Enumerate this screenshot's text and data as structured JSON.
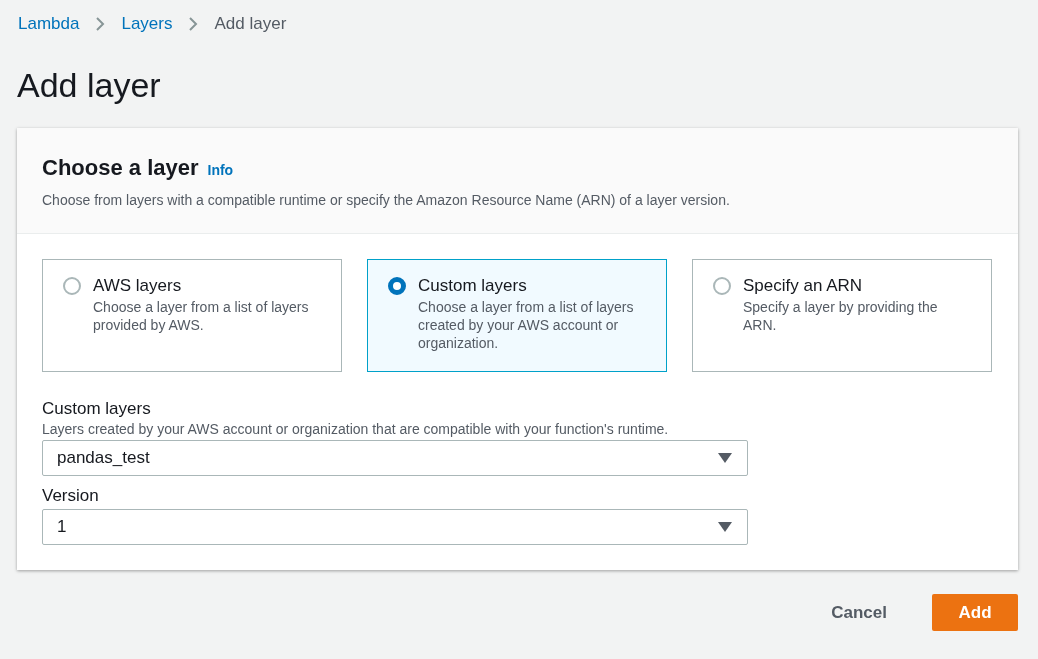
{
  "breadcrumbs": [
    {
      "label": "Lambda",
      "kind": "link"
    },
    {
      "label": "Layers",
      "kind": "link"
    },
    {
      "label": "Add layer",
      "kind": "current"
    }
  ],
  "title": "Add layer",
  "panel": {
    "title": "Choose a layer",
    "info_link": "Info",
    "description": "Choose from layers with a compatible runtime or specify the Amazon Resource Name (ARN) of a layer version.",
    "options": [
      {
        "label": "AWS layers",
        "description": "Choose a layer from a list of layers provided by AWS.",
        "selected": false
      },
      {
        "label": "Custom layers",
        "description": "Choose a layer from a list of layers created by your AWS account or organization.",
        "selected": true
      },
      {
        "label": "Specify an ARN",
        "description": "Specify a layer by providing the ARN.",
        "selected": false
      }
    ],
    "fields": [
      {
        "label": "Custom layers",
        "description": "Layers created by your AWS account or organization that are compatible with your function's runtime.",
        "value": "pandas_test"
      },
      {
        "label": "Version",
        "value": "1"
      }
    ]
  },
  "buttons": [
    {
      "label": "Cancel",
      "kind": "link"
    },
    {
      "label": "Add",
      "kind": "primary"
    }
  ]
}
